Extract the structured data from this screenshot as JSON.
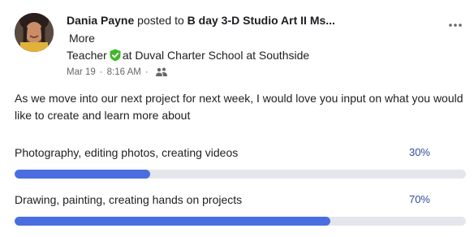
{
  "post": {
    "author": "Dania Payne",
    "posted_to": "posted to",
    "group": "B day 3-D Studio Art II Ms...",
    "more": "More",
    "role": "Teacher",
    "school": "at Duval Charter School at Southside",
    "date": "Mar 19",
    "time": "8:16 AM",
    "separator": "·",
    "body": "As we move into our next project for next week, I would love you input on what you would like to create and learn more about"
  },
  "poll": {
    "options": [
      {
        "label": "Photography, editing photos, creating videos",
        "percent_label": "30%",
        "percent": 30
      },
      {
        "label": "Drawing, painting, creating hands on projects",
        "percent_label": "70%",
        "percent": 70
      }
    ]
  },
  "colors": {
    "bar_fill": "#4a6ee0",
    "bar_track": "#e4e6eb",
    "percent_text": "#2d4a9a",
    "badge": "#42b72a"
  },
  "icons": {
    "options": "more-options-icon",
    "badge": "verified-teacher-badge-icon",
    "audience": "audience-icon"
  }
}
